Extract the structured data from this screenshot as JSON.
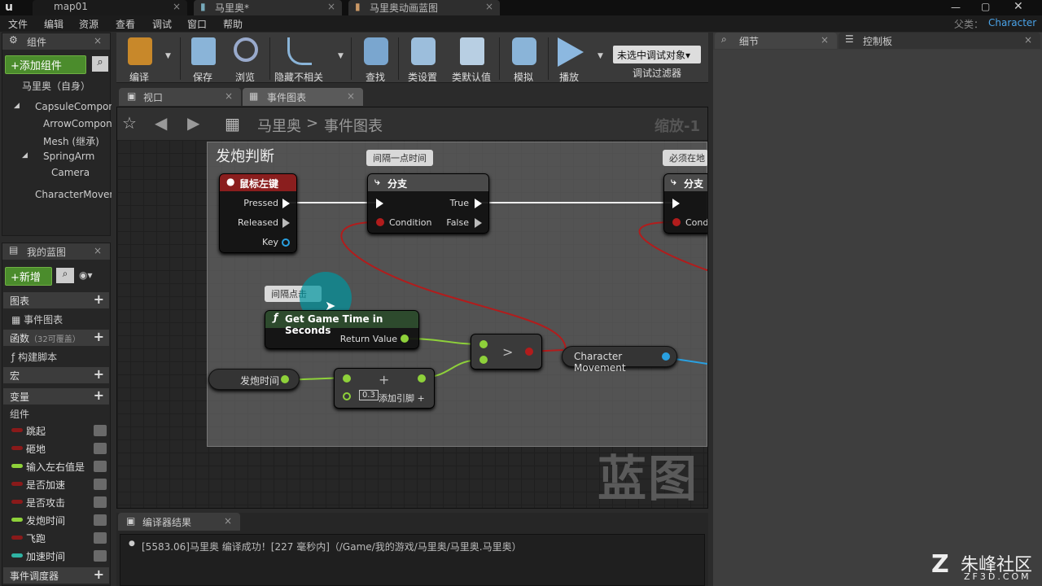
{
  "titlebar": {
    "tabs": [
      {
        "label": "map01"
      },
      {
        "label": "马里奥*"
      },
      {
        "label": "马里奥动画蓝图"
      }
    ],
    "parent_label": "父类：",
    "parent_value": "Character"
  },
  "menu": [
    "文件",
    "编辑",
    "资源",
    "查看",
    "调试",
    "窗口",
    "帮助"
  ],
  "components": {
    "title": "组件",
    "add_button": "+添加组件",
    "self": "马里奥（自身）",
    "items": [
      "CapsuleCompon",
      "ArrowCompone",
      "Mesh (继承)",
      "SpringArm",
      "Camera",
      "CharacterMovem"
    ]
  },
  "myblueprint": {
    "title": "我的蓝图",
    "new_button": "+新增",
    "graphs": "图表",
    "event_graph": "事件图表",
    "functions": "函数",
    "functions_note": "（32可覆盖）",
    "construction": "构建脚本",
    "macros": "宏",
    "variables": "变量",
    "components_cat": "组件",
    "vars": [
      {
        "name": "跳起",
        "color": "#8a1a1a"
      },
      {
        "name": "砸地",
        "color": "#8a1a1a"
      },
      {
        "name": "输入左右值是",
        "color": "#8ed13a"
      },
      {
        "name": "是否加速",
        "color": "#8a1a1a"
      },
      {
        "name": "是否攻击",
        "color": "#8a1a1a"
      },
      {
        "name": "发炮时间",
        "color": "#8ed13a"
      },
      {
        "name": "飞跑",
        "color": "#8a1a1a"
      },
      {
        "name": "加速时间",
        "color": "#2fb3a3"
      }
    ],
    "dispatchers": "事件调度器"
  },
  "toolbar": {
    "compile": "编译",
    "save": "保存",
    "browse": "浏览",
    "hide": "隐藏不相关",
    "find": "查找",
    "class_settings": "类设置",
    "class_defaults": "类默认值",
    "simulate": "模拟",
    "play": "播放",
    "debug_select": "未选中调试对象▾",
    "debug_filter": "调试过滤器"
  },
  "editor_tabs": [
    "视口",
    "事件图表"
  ],
  "breadcrumb": {
    "root": "马里奥",
    "sep": ">",
    "current": "事件图表",
    "zoom": "缩放-1"
  },
  "graph": {
    "comment_title": "发炮判断",
    "bubbles": [
      "间隔一点时间",
      "必须在地",
      "间隔点击"
    ],
    "mouse_node": {
      "title": "鼠标左键",
      "pressed": "Pressed",
      "released": "Released",
      "key": "Key"
    },
    "branch1": {
      "title": "分支",
      "true": "True",
      "false": "False",
      "condition": "Condition"
    },
    "branch2": {
      "title": "分支",
      "condition": "Cond"
    },
    "gametime": {
      "title": "Get Game Time in Seconds",
      "ret": "Return Value"
    },
    "compare": ">",
    "charmove": "Character Movement",
    "firevar": "发炮时间",
    "add": {
      "value": "0.3",
      "label": "添加引脚 +",
      "plus": "+"
    },
    "watermark": "蓝图"
  },
  "rightpanel": {
    "details": "细节",
    "control": "控制板"
  },
  "compiler": {
    "title": "编译器结果",
    "message": "[5583.06]马里奥 编译成功！[227 毫秒内]（/Game/我的游戏/马里奥/马里奥.马里奥）"
  },
  "logo": {
    "text": "朱峰社区",
    "sub": "ZF3D.COM"
  }
}
